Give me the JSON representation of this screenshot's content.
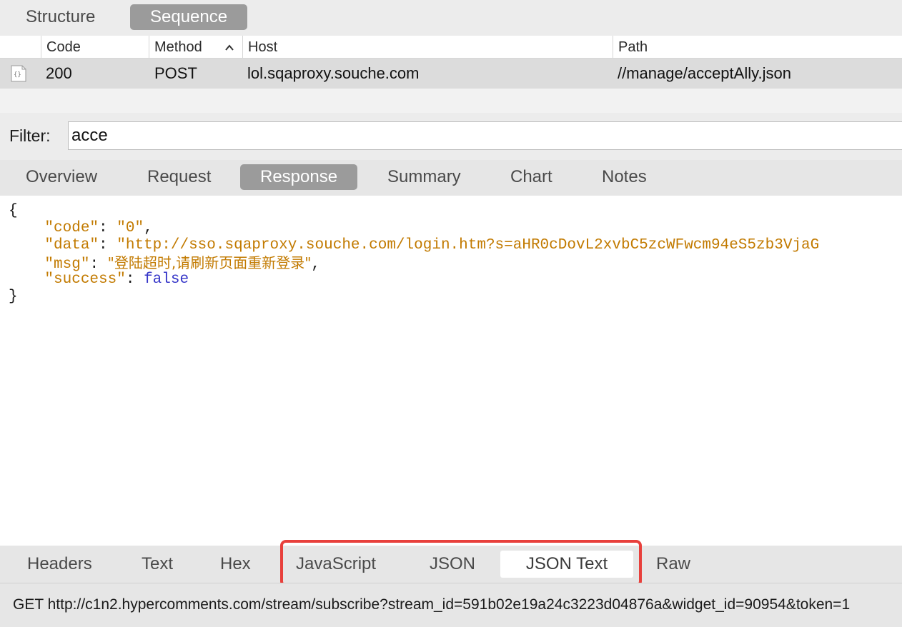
{
  "top_tabs": [
    {
      "label": "Structure",
      "active": false
    },
    {
      "label": "Sequence",
      "active": true
    }
  ],
  "table": {
    "columns": [
      "Code",
      "Method",
      "Host",
      "Path"
    ],
    "rows": [
      {
        "icon": "json-file-icon",
        "code": "200",
        "method": "POST",
        "host": "lol.sqaproxy.souche.com",
        "path": "//manage/acceptAlly.json"
      }
    ]
  },
  "filter": {
    "label": "Filter:",
    "value": "acce"
  },
  "detail_tabs": [
    {
      "label": "Overview",
      "active": false
    },
    {
      "label": "Request",
      "active": false
    },
    {
      "label": "Response",
      "active": true
    },
    {
      "label": "Summary",
      "active": false
    },
    {
      "label": "Chart",
      "active": false
    },
    {
      "label": "Notes",
      "active": false
    }
  ],
  "response_body": {
    "open_brace": "{",
    "close_brace": "}",
    "entries": [
      {
        "key": "\"code\"",
        "value": "\"0\"",
        "type": "string",
        "trailing": ","
      },
      {
        "key": "\"data\"",
        "value": "\"http://sso.sqaproxy.souche.com/login.htm?s=aHR0cDovL2xvbC5zcWFwcm94eS5zb3VjaG",
        "type": "string",
        "trailing": ""
      },
      {
        "key": "\"msg\"",
        "value": "\"登陆超时,请刷新页面重新登录\"",
        "type": "string",
        "trailing": ","
      },
      {
        "key": "\"success\"",
        "value": "false",
        "type": "boolean",
        "trailing": ""
      }
    ]
  },
  "view_tabs": [
    {
      "label": "Headers",
      "active": false
    },
    {
      "label": "Text",
      "active": false
    },
    {
      "label": "Hex",
      "active": false
    },
    {
      "label": "JavaScript",
      "active": false
    },
    {
      "label": "JSON",
      "active": false
    },
    {
      "label": "JSON Text",
      "active": true
    },
    {
      "label": "Raw",
      "active": false
    }
  ],
  "status": {
    "text": "GET http://c1n2.hypercomments.com/stream/subscribe?stream_id=591b02e19a24c3223d04876a&widget_id=90954&token=1"
  },
  "colors": {
    "active_tab": "#9b9b9b",
    "json_key": "#c27a00",
    "json_boolean": "#3535c8",
    "highlight": "#e8403c"
  }
}
